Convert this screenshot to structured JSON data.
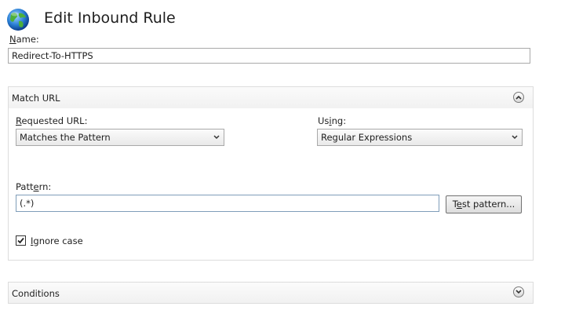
{
  "header": {
    "title": "Edit Inbound Rule",
    "icon": "globe-icon"
  },
  "name": {
    "label_prefix": "N",
    "label_rest": "ame:",
    "value": "Redirect-To-HTTPS"
  },
  "match_url": {
    "title": "Match URL",
    "requested_url": {
      "label_prefix": "R",
      "label_rest": "equested URL:",
      "value": "Matches the Pattern"
    },
    "using": {
      "label_prefix": "Us",
      "label_u": "i",
      "label_rest": "ng:",
      "value": "Regular Expressions"
    },
    "pattern": {
      "label_prefix": "Patt",
      "label_u": "e",
      "label_rest": "rn:",
      "value": "(.*)"
    },
    "test_button": {
      "prefix": "T",
      "u": "e",
      "rest": "st pattern..."
    },
    "ignore_case": {
      "checked": true,
      "label_u": "I",
      "label_rest": "gnore case"
    }
  },
  "conditions": {
    "title": "Conditions"
  }
}
